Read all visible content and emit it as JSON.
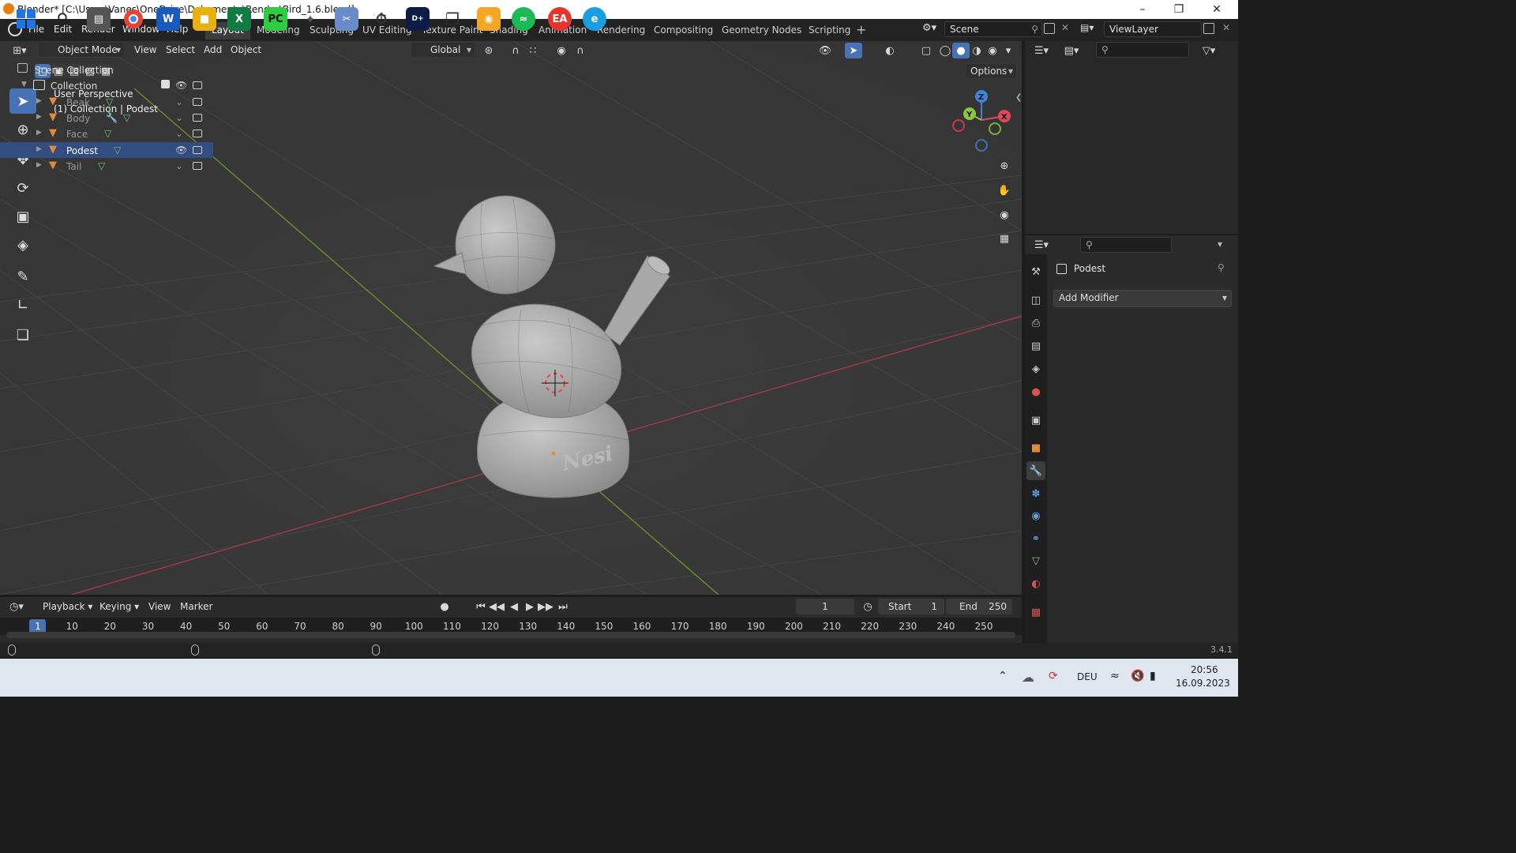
{
  "window": {
    "title": "Blender* [C:\\Users\\Vanes\\OneDrive\\Dokumente\\Render\\Bird_1.6.blend]"
  },
  "menu": [
    "File",
    "Edit",
    "Render",
    "Window",
    "Help"
  ],
  "workspaces": [
    "Layout",
    "Modeling",
    "Sculpting",
    "UV Editing",
    "Texture Paint",
    "Shading",
    "Animation",
    "Rendering",
    "Compositing",
    "Geometry Nodes",
    "Scripting"
  ],
  "scene": {
    "name": "Scene",
    "view_layer": "ViewLayer"
  },
  "viewport_header": {
    "mode": "Object Mode",
    "menus": [
      "View",
      "Select",
      "Add",
      "Object"
    ],
    "orientation": "Global",
    "options_label": "Options"
  },
  "viewport": {
    "perspective": "User Perspective",
    "context": "(1) Collection | Podest",
    "pedestal_text": "Nesi"
  },
  "gizmo": {
    "x": "X",
    "y": "Y",
    "z": "Z"
  },
  "outliner": {
    "root": "Scene Collection",
    "collection": "Collection",
    "objects": [
      {
        "name": "Beak"
      },
      {
        "name": "Body"
      },
      {
        "name": "Face"
      },
      {
        "name": "Podest"
      },
      {
        "name": "Tail"
      }
    ]
  },
  "properties": {
    "object_name": "Podest",
    "add_modifier_label": "Add Modifier"
  },
  "timeline": {
    "menus": [
      "Playback",
      "Keying",
      "View",
      "Marker"
    ],
    "current_frame": "1",
    "start_label": "Start",
    "start": "1",
    "end_label": "End",
    "end": "250",
    "ruler_ticks": [
      "1",
      "10",
      "20",
      "30",
      "40",
      "50",
      "60",
      "70",
      "80",
      "90",
      "100",
      "110",
      "120",
      "130",
      "140",
      "150",
      "160",
      "170",
      "180",
      "190",
      "200",
      "210",
      "220",
      "230",
      "240",
      "250"
    ]
  },
  "status": {
    "version": "3.4.1"
  },
  "taskbar": {
    "language": "DEU",
    "time": "20:56",
    "date": "16.09.2023"
  },
  "colors": {
    "accent": "#4772b3",
    "x_axis": "#e3485a",
    "y_axis": "#8cc63e",
    "z_axis": "#3e84d8",
    "mesh_icon": "#e08a3c",
    "data_icon": "#6fc56f"
  }
}
